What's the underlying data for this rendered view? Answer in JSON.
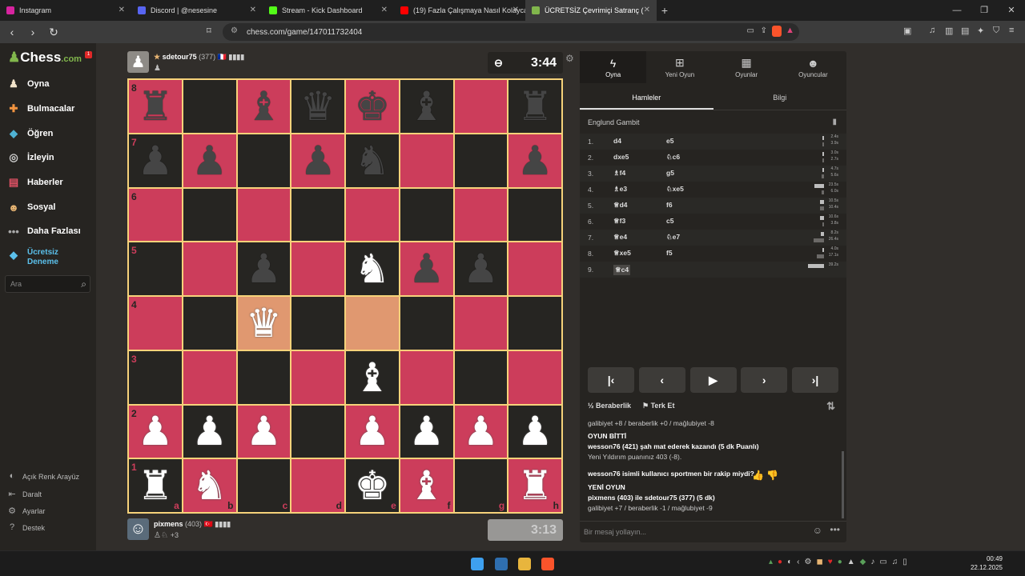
{
  "browser": {
    "tabs": [
      {
        "label": "Instagram",
        "color": "#d6249f"
      },
      {
        "label": "Discord | @nesesine",
        "color": "#5865f2"
      },
      {
        "label": "Stream - Kick Dashboard",
        "color": "#53fc18"
      },
      {
        "label": "(19) Fazla Çalışmaya Nasıl Kolayca İka",
        "color": "#ff0000"
      },
      {
        "label": "ÜCRETSİZ Çevrimiçi Satranç (",
        "color": "#81b64c"
      }
    ],
    "new_tab": "+",
    "url": "chess.com/game/147011732404"
  },
  "sidebar": {
    "logo": "Chess",
    "logo_suffix": ".com",
    "notif": "1",
    "items": [
      {
        "label": "Oyna",
        "icon": "play-icon",
        "color": "#f1e3c9"
      },
      {
        "label": "Bulmacalar",
        "icon": "puzzle-icon",
        "color": "#f29440"
      },
      {
        "label": "Öğren",
        "icon": "learn-icon",
        "color": "#4fb2d3"
      },
      {
        "label": "İzleyin",
        "icon": "binoculars-icon",
        "color": "#cfcfcf"
      },
      {
        "label": "Haberler",
        "icon": "news-icon",
        "color": "#e35266"
      },
      {
        "label": "Sosyal",
        "icon": "social-icon",
        "color": "#e7b472"
      },
      {
        "label": "Daha Fazlası",
        "icon": "more-icon",
        "color": "#aaaaaa"
      }
    ],
    "premium": "Ücretsiz Deneme",
    "search_placeholder": "Ara",
    "bottom": [
      {
        "label": "Açık Renk Arayüz",
        "icon": "contrast-icon"
      },
      {
        "label": "Daralt",
        "icon": "collapse-icon"
      },
      {
        "label": "Ayarlar",
        "icon": "settings-icon"
      },
      {
        "label": "Destek",
        "icon": "help-icon"
      }
    ]
  },
  "top_player": {
    "name": "sdetour75",
    "rating": "(377)",
    "flag": "🇫🇷",
    "clock": "3:44",
    "captured": "♟"
  },
  "bottom_player": {
    "name": "pixmens",
    "rating": "(403)",
    "flag": "🇹🇷",
    "clock": "3:13",
    "captured": "♙♘",
    "advantage": "+3"
  },
  "board": {
    "files": [
      "a",
      "b",
      "c",
      "d",
      "e",
      "f",
      "g",
      "h"
    ],
    "ranks": [
      "8",
      "7",
      "6",
      "5",
      "4",
      "3",
      "2",
      "1"
    ],
    "position": [
      [
        "br",
        "",
        "bb",
        "bq",
        "bk",
        "bb",
        "",
        "br"
      ],
      [
        "bp",
        "bp",
        "",
        "bp",
        "bn",
        "",
        "",
        "bp"
      ],
      [
        "",
        "",
        "",
        "",
        "",
        "",
        "",
        ""
      ],
      [
        "",
        "",
        "bp",
        "",
        "wn",
        "bp",
        "bp",
        ""
      ],
      [
        "",
        "",
        "wq",
        "",
        "",
        "",
        "",
        ""
      ],
      [
        "",
        "",
        "",
        "",
        "wb",
        "",
        "",
        ""
      ],
      [
        "wp",
        "wp",
        "wp",
        "",
        "wp",
        "wp",
        "wp",
        "wp"
      ],
      [
        "wr",
        "wn",
        "",
        "",
        "wk",
        "wb",
        "",
        "wr"
      ]
    ],
    "highlights": [
      "c4",
      "e4"
    ]
  },
  "panel": {
    "tabs": [
      {
        "label": "Oyna",
        "icon": "bolt-icon"
      },
      {
        "label": "Yeni Oyun",
        "icon": "plus-icon"
      },
      {
        "label": "Oyunlar",
        "icon": "board-icon"
      },
      {
        "label": "Oyuncular",
        "icon": "players-icon"
      }
    ],
    "subtabs": [
      "Hamleler",
      "Bilgi"
    ],
    "opening": "Englund Gambit",
    "moves": [
      {
        "n": "1.",
        "w": "d4",
        "b": "e5",
        "tw": "2.4s",
        "tb": "3.9s",
        "fw": 0.06,
        "fb": 0.1
      },
      {
        "n": "2.",
        "w": "dxe5",
        "b": "♘c6",
        "tw": "3.0s",
        "tb": "2.7s",
        "fw": 0.08,
        "fb": 0.07
      },
      {
        "n": "3.",
        "w": "♗f4",
        "b": "g5",
        "tw": "4.7s",
        "tb": "5.6s",
        "fw": 0.12,
        "fb": 0.14
      },
      {
        "n": "4.",
        "w": "♗e3",
        "b": "♘xe5",
        "tw": "23.5s",
        "tb": "6.0s",
        "fw": 0.6,
        "fb": 0.15
      },
      {
        "n": "5.",
        "w": "♕d4",
        "b": "f6",
        "tw": "10.5s",
        "tb": "10.4s",
        "fw": 0.27,
        "fb": 0.27
      },
      {
        "n": "6.",
        "w": "♕f3",
        "b": "c5",
        "tw": "10.6s",
        "tb": "3.8s",
        "fw": 0.27,
        "fb": 0.1
      },
      {
        "n": "7.",
        "w": "♕e4",
        "b": "♘e7",
        "tw": "8.2s",
        "tb": "26.4s",
        "fw": 0.21,
        "fb": 0.67
      },
      {
        "n": "8.",
        "w": "♕xe5",
        "b": "f5",
        "tw": "4.0s",
        "tb": "17.1s",
        "fw": 0.1,
        "fb": 0.44
      },
      {
        "n": "9.",
        "w": "♕c4",
        "b": "",
        "tw": "39.2s",
        "tb": "",
        "fw": 1.0,
        "fb": 0
      }
    ],
    "draw": "Beraberlik",
    "resign": "Terk Et",
    "chat": [
      {
        "t": "galibiyet +8 / beraberlik +0 / mağlubiyet -8",
        "bold": false
      },
      {
        "t": "OYUN BİTTİ",
        "bold": true
      },
      {
        "t": "wesson76 (421) şah mat ederek kazandı (5 dk Puanlı)",
        "bold": false
      },
      {
        "t": "Yeni Yıldırım puanınız 403 (-8).",
        "bold": false
      },
      {
        "t": "wesson76 isimli kullanıcı sportmen bir rakip miydi?",
        "bold": false
      },
      {
        "t": "YENİ OYUN",
        "bold": true
      },
      {
        "t": "pixmens (403) ile sdetour75 (377) (5 dk)",
        "bold": false
      },
      {
        "t": "galibiyet +7 / beraberlik -1 / mağlubiyet -9",
        "bold": false
      }
    ],
    "chat_placeholder": "Bir mesaj yollayın..."
  },
  "taskbar": {
    "time": "00:49",
    "date": "22.12.2025"
  }
}
